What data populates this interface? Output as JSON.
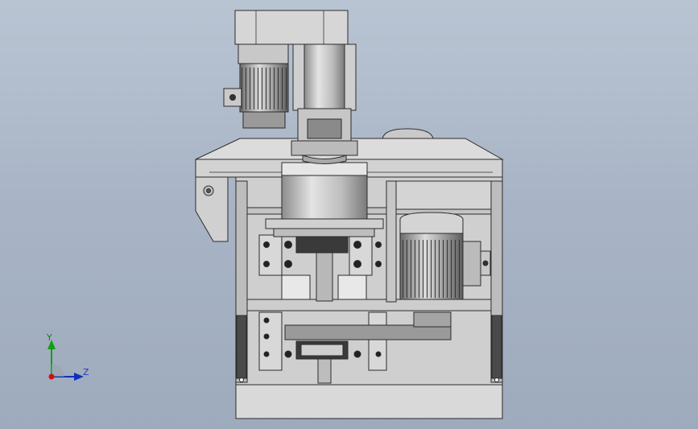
{
  "viewport": {
    "background_top": "#b9c4d3",
    "background_bottom": "#9eabbd"
  },
  "model": {
    "body_color": "#d6d6d6",
    "edge_color": "#2b2b2b",
    "shade_color": "#8f8f8f",
    "dark_color": "#3c3c3c"
  },
  "triad": {
    "y_label": "Y",
    "z_label": "Z",
    "x_color": "#d01010",
    "y_color": "#10a010",
    "z_color": "#1030c0"
  }
}
